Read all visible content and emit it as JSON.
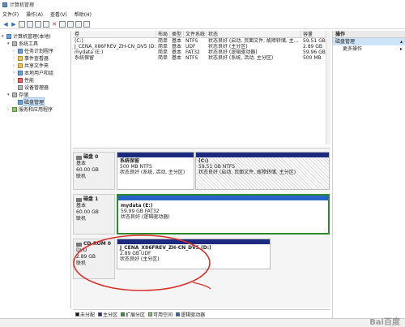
{
  "window": {
    "title": "计算机管理"
  },
  "menu": [
    "文件(F)",
    "操作(A)",
    "查看(V)",
    "帮助(H)"
  ],
  "tree": [
    {
      "label": "计算机管理(本地)",
      "indent": 0,
      "exp": "▾",
      "icon": "computer-icon"
    },
    {
      "label": "系统工具",
      "indent": 1,
      "exp": "▾",
      "icon": "tools-icon"
    },
    {
      "label": "任务计划程序",
      "indent": 2,
      "exp": "›",
      "icon": "task-scheduler-icon"
    },
    {
      "label": "事件查看器",
      "indent": 2,
      "exp": "›",
      "icon": "event-viewer-icon"
    },
    {
      "label": "共享文件夹",
      "indent": 2,
      "exp": "›",
      "icon": "shared-folder-icon"
    },
    {
      "label": "本地用户和组",
      "indent": 2,
      "exp": "›",
      "icon": "users-icon"
    },
    {
      "label": "性能",
      "indent": 2,
      "exp": "›",
      "icon": "performance-icon"
    },
    {
      "label": "设备管理器",
      "indent": 2,
      "exp": "",
      "icon": "device-manager-icon"
    },
    {
      "label": "存储",
      "indent": 1,
      "exp": "▾",
      "icon": "storage-icon"
    },
    {
      "label": "磁盘管理",
      "indent": 2,
      "exp": "",
      "icon": "disk-management-icon",
      "selected": true
    },
    {
      "label": "服务和应用程序",
      "indent": 1,
      "exp": "›",
      "icon": "services-icon"
    }
  ],
  "volume_table": {
    "headers": [
      "卷",
      "布局",
      "类型",
      "文件系统",
      "状态",
      "容量"
    ],
    "rows": [
      [
        "(C:)",
        "简单",
        "基本",
        "NTFS",
        "状态良好 (启动, 页面文件, 故障转储, 主...",
        "59.51 GB"
      ],
      [
        "J_CENA_X86FREV_ZH-CN_DV5 (D:)",
        "简单",
        "基本",
        "UDF",
        "状态良好 (主分区)",
        "2.89 GB"
      ],
      [
        "mydata (E:)",
        "简单",
        "基本",
        "FAT32",
        "状态良好 (逻辑驱动器)",
        "59.96 GB"
      ],
      [
        "系统保留",
        "简单",
        "基本",
        "NTFS",
        "状态良好 (系统, 活动, 主分区)",
        "500 MB"
      ]
    ]
  },
  "disks": [
    {
      "name": "磁盘 0",
      "type": "基本",
      "size": "60.00 GB",
      "status": "联机",
      "parts": [
        {
          "name": "系统保留",
          "detail": "500 MB NTFS",
          "status": "状态良好 (系统, 活动, 主分区)"
        },
        {
          "name": "(C:)",
          "detail": "59.51 GB NTFS",
          "status": "状态良好 (启动, 页面文件, 故障转储, 主分区)"
        }
      ]
    },
    {
      "name": "磁盘 1",
      "type": "基本",
      "size": "60.00 GB",
      "status": "联机",
      "parts": [
        {
          "name": "mydata (E:)",
          "detail": "59.99 GB FAT32",
          "status": "状态良好 (逻辑驱动器)"
        }
      ]
    },
    {
      "name": "CD-ROM 0",
      "type": "DVD",
      "size": "2.89 GB",
      "status": "联机",
      "parts": [
        {
          "name": "J_CENA_X86FREV_ZH-CN_DV5 (D:)",
          "detail": "2.89 GB UDF",
          "status": "状态良好 (主分区)"
        }
      ]
    }
  ],
  "legend": [
    {
      "label": "未分配",
      "color": "#111111"
    },
    {
      "label": "主分区",
      "color": "#1c2a80"
    },
    {
      "label": "扩展分区",
      "color": "#2e9a2e"
    },
    {
      "label": "可用空间",
      "color": "#8ed26a"
    },
    {
      "label": "逻辑驱动器",
      "color": "#2563c9"
    }
  ],
  "actions": {
    "header": "操作",
    "selected": "磁盘管理",
    "more": "更多操作"
  },
  "colors": {
    "annotation": "#d9302c",
    "primary_partition": "#1c2a80",
    "logical_drive": "#2563c9"
  }
}
